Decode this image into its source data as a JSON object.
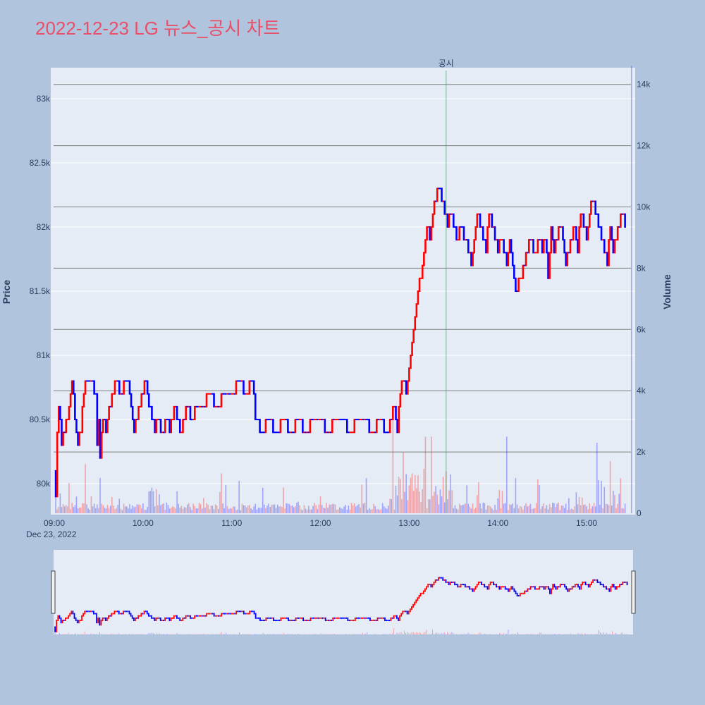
{
  "title": "2022-12-23 LG 뉴스_공시 차트",
  "colors": {
    "title": "#e8506a",
    "up": "#ff0000",
    "down": "#0000ff",
    "plot_bg": "#e5ecf6",
    "page_bg": "#b0c4de",
    "annotation_line": "#2e8b57"
  },
  "chart_data": {
    "type": "candlestick",
    "xlabel": "",
    "x_tick_labels": [
      "09:00",
      "10:00",
      "11:00",
      "12:00",
      "13:00",
      "14:00",
      "15:00"
    ],
    "x_sublabel": "Dec 23, 2022",
    "ylabel": "Price",
    "y_ticks": [
      80000,
      80500,
      81000,
      81500,
      82000,
      82500,
      83000
    ],
    "y_tick_labels": [
      "80k",
      "80.5k",
      "81k",
      "81.5k",
      "82k",
      "82.5k",
      "83k"
    ],
    "ylim": [
      79770,
      83230
    ],
    "y2label": "Volume",
    "y2_ticks": [
      0,
      2000,
      4000,
      6000,
      8000,
      10000,
      12000,
      14000
    ],
    "y2_tick_labels": [
      "0",
      "2k",
      "4k",
      "6k",
      "8k",
      "10k",
      "12k",
      "14k"
    ],
    "y2lim": [
      0,
      14500
    ],
    "x_range_minutes": [
      0,
      390
    ],
    "annotation": {
      "label": "공시",
      "minute": 265
    },
    "price_path": [
      [
        0,
        80100
      ],
      [
        1,
        79900
      ],
      [
        2,
        80400
      ],
      [
        3,
        80600
      ],
      [
        5,
        80300
      ],
      [
        7,
        80400
      ],
      [
        10,
        80600
      ],
      [
        12,
        80800
      ],
      [
        14,
        80500
      ],
      [
        16,
        80300
      ],
      [
        18,
        80400
      ],
      [
        20,
        80700
      ],
      [
        22,
        80800
      ],
      [
        25,
        80800
      ],
      [
        28,
        80700
      ],
      [
        29,
        80300
      ],
      [
        30,
        80500
      ],
      [
        31,
        80200
      ],
      [
        33,
        80500
      ],
      [
        35,
        80400
      ],
      [
        37,
        80600
      ],
      [
        40,
        80700
      ],
      [
        42,
        80800
      ],
      [
        45,
        80700
      ],
      [
        48,
        80800
      ],
      [
        50,
        80800
      ],
      [
        52,
        80600
      ],
      [
        54,
        80400
      ],
      [
        56,
        80500
      ],
      [
        58,
        80600
      ],
      [
        60,
        80700
      ],
      [
        62,
        80800
      ],
      [
        64,
        80600
      ],
      [
        66,
        80500
      ],
      [
        68,
        80400
      ],
      [
        70,
        80500
      ],
      [
        73,
        80400
      ],
      [
        76,
        80500
      ],
      [
        78,
        80400
      ],
      [
        80,
        80500
      ],
      [
        82,
        80600
      ],
      [
        85,
        80400
      ],
      [
        88,
        80500
      ],
      [
        90,
        80600
      ],
      [
        93,
        80500
      ],
      [
        96,
        80600
      ],
      [
        100,
        80600
      ],
      [
        105,
        80700
      ],
      [
        110,
        80600
      ],
      [
        115,
        80700
      ],
      [
        120,
        80700
      ],
      [
        125,
        80800
      ],
      [
        130,
        80700
      ],
      [
        134,
        80800
      ],
      [
        136,
        80500
      ],
      [
        140,
        80400
      ],
      [
        145,
        80500
      ],
      [
        150,
        80400
      ],
      [
        155,
        80500
      ],
      [
        160,
        80400
      ],
      [
        165,
        80500
      ],
      [
        170,
        80400
      ],
      [
        175,
        80500
      ],
      [
        180,
        80500
      ],
      [
        185,
        80400
      ],
      [
        190,
        80500
      ],
      [
        195,
        80500
      ],
      [
        200,
        80400
      ],
      [
        205,
        80500
      ],
      [
        210,
        80500
      ],
      [
        215,
        80400
      ],
      [
        220,
        80500
      ],
      [
        225,
        80400
      ],
      [
        228,
        80500
      ],
      [
        230,
        80600
      ],
      [
        232,
        80400
      ],
      [
        234,
        80700
      ],
      [
        236,
        80800
      ],
      [
        238,
        80700
      ],
      [
        240,
        80900
      ],
      [
        242,
        81100
      ],
      [
        244,
        81300
      ],
      [
        246,
        81500
      ],
      [
        248,
        81600
      ],
      [
        250,
        81800
      ],
      [
        252,
        82000
      ],
      [
        254,
        81900
      ],
      [
        256,
        82100
      ],
      [
        258,
        82200
      ],
      [
        260,
        82300
      ],
      [
        262,
        82200
      ],
      [
        264,
        82100
      ],
      [
        266,
        82000
      ],
      [
        268,
        82100
      ],
      [
        270,
        82000
      ],
      [
        272,
        81900
      ],
      [
        275,
        82000
      ],
      [
        278,
        81900
      ],
      [
        280,
        81800
      ],
      [
        282,
        81700
      ],
      [
        284,
        81900
      ],
      [
        286,
        82100
      ],
      [
        288,
        82000
      ],
      [
        290,
        81900
      ],
      [
        292,
        81800
      ],
      [
        294,
        82100
      ],
      [
        296,
        82000
      ],
      [
        298,
        81900
      ],
      [
        300,
        81800
      ],
      [
        302,
        81900
      ],
      [
        304,
        81800
      ],
      [
        306,
        81700
      ],
      [
        308,
        81900
      ],
      [
        310,
        81700
      ],
      [
        312,
        81500
      ],
      [
        315,
        81600
      ],
      [
        318,
        81700
      ],
      [
        320,
        81800
      ],
      [
        322,
        81900
      ],
      [
        325,
        81800
      ],
      [
        328,
        81900
      ],
      [
        330,
        81800
      ],
      [
        332,
        81900
      ],
      [
        334,
        81600
      ],
      [
        336,
        82000
      ],
      [
        338,
        81800
      ],
      [
        340,
        81900
      ],
      [
        342,
        82000
      ],
      [
        344,
        81900
      ],
      [
        346,
        81700
      ],
      [
        348,
        81800
      ],
      [
        350,
        81900
      ],
      [
        352,
        82000
      ],
      [
        354,
        81800
      ],
      [
        356,
        82100
      ],
      [
        358,
        82000
      ],
      [
        360,
        81900
      ],
      [
        362,
        82100
      ],
      [
        364,
        82200
      ],
      [
        366,
        82100
      ],
      [
        368,
        82000
      ],
      [
        370,
        81900
      ],
      [
        372,
        81800
      ],
      [
        374,
        81700
      ],
      [
        376,
        82000
      ],
      [
        378,
        81800
      ],
      [
        380,
        81900
      ],
      [
        382,
        82000
      ],
      [
        384,
        82100
      ],
      [
        386,
        82000
      ]
    ],
    "series": [
      {
        "name": "",
        "type": "candlestick"
      },
      {
        "name": "",
        "type": "volume"
      }
    ]
  }
}
